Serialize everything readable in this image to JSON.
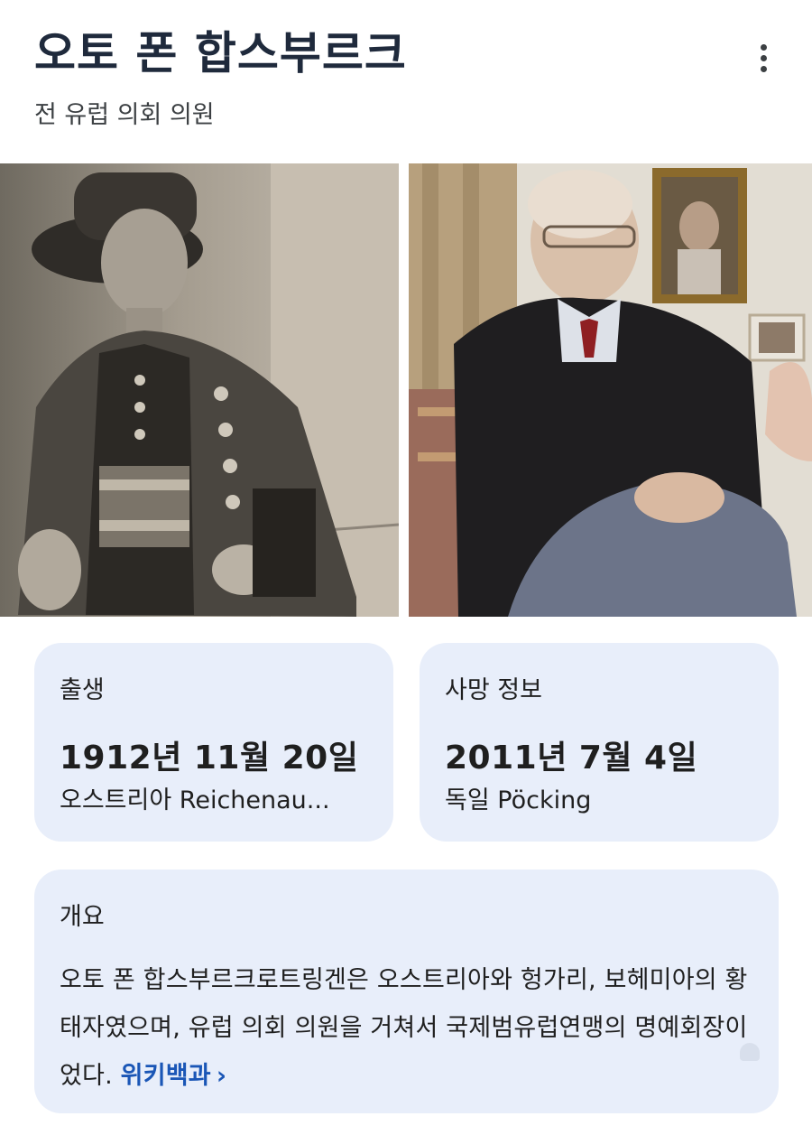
{
  "entity": {
    "title": "오토 폰 합스부르크",
    "subtitle": "전 유럽 의회 의원"
  },
  "icons": {
    "more": "more-vert-icon",
    "chevron": "chevron-right-icon"
  },
  "born": {
    "label": "출생",
    "date": "1912년 11월 20일",
    "place": "오스트리아 Reichenau..."
  },
  "died": {
    "label": "사망 정보",
    "date": "2011년 7월 4일",
    "place": "독일 Pöcking"
  },
  "overview": {
    "label": "개요",
    "text": "오토 폰 합스부르크로트링겐은 오스트리아와 헝가리, 보헤미아의 황태자였으며, 유럽 의회 의원을 거쳐서 국제범유럽연맹의 명예회장이었다.",
    "link_label": "위키백과",
    "chevron": "›"
  },
  "colors": {
    "card_bg": "#e8eefa",
    "title": "#1f2a3c",
    "link": "#1a56b6"
  }
}
